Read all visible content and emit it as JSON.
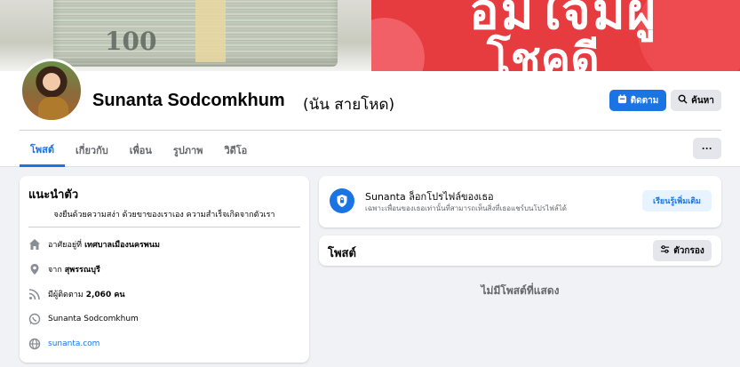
{
  "cover": {
    "money_text": "100",
    "banner_line1": "อิ่มใจมีผู้",
    "banner_line2": "โชคดี"
  },
  "profile": {
    "name": "Sunanta Sodcomkhum",
    "alt_name": "(นัน สายโหด)",
    "follow_label": "ติดตาม",
    "search_label": "ค้นหา",
    "more_label": "···"
  },
  "tabs": [
    {
      "label": "โพสต์",
      "active": true
    },
    {
      "label": "เกี่ยวกับ",
      "active": false
    },
    {
      "label": "เพื่อน",
      "active": false
    },
    {
      "label": "รูปภาพ",
      "active": false
    },
    {
      "label": "วิดีโอ",
      "active": false
    }
  ],
  "intro": {
    "title": "แนะนำตัว",
    "bio": "จงยืนด้วยความสง่า ด้วยขาของเราเอง ความสำเร็จเกิดจากตัวเรา",
    "lives_prefix": "อาศัยอยู่ที่",
    "lives_value": "เทศบาลเมืองนครพนม",
    "from_prefix": "จาก",
    "from_value": "สุพรรณบุรี",
    "followers_prefix": "มีผู้ติดตาม",
    "followers_value": "2,060 คน",
    "whatsapp": "Sunanta Sodcomkhum",
    "website": "sunanta.com"
  },
  "locked": {
    "title": "Sunanta ล็อกโปรไฟล์ของเธอ",
    "subtitle": "เฉพาะเพื่อนของเธอเท่านั้นที่สามารถเห็นสิ่งที่เธอแชร์บนโปรไฟล์ได้",
    "learn_label": "เรียนรู้เพิ่มเติม"
  },
  "posts": {
    "title": "โพสต์",
    "filter_label": "ตัวกรอง",
    "empty": "ไม่มีโพสต์ที่แสดง"
  },
  "colors": {
    "accent": "#1b74e4",
    "background": "#f0f2f5",
    "cover_red": "#e63b3f"
  }
}
